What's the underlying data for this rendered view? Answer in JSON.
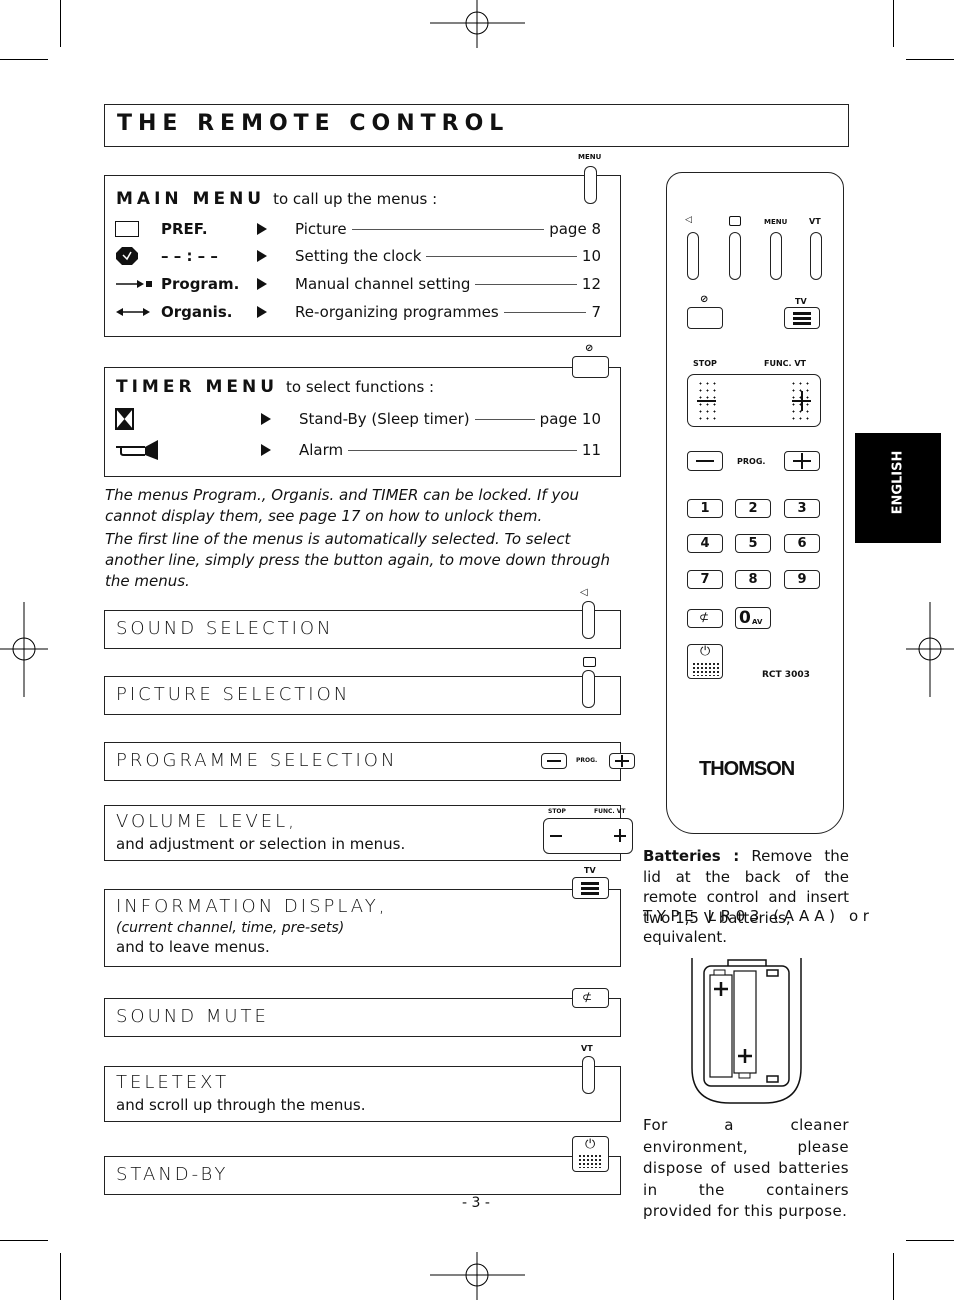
{
  "title": "THE REMOTE CONTROL",
  "language_tab": "ENGLISH",
  "page_number": "- 3 -",
  "main_menu": {
    "heading": "MAIN MENU",
    "subtitle": "to call up the menus :",
    "button_label": "MENU",
    "items": [
      {
        "icon": "screen-icon",
        "name": "PREF.",
        "desc": "Picture",
        "page": "page 8"
      },
      {
        "icon": "clock-icon",
        "name": "– – : – –",
        "desc": "Setting the clock",
        "page": "10"
      },
      {
        "icon": "arrow-right-icon",
        "name": "Program.",
        "desc": "Manual channel setting",
        "page": "12"
      },
      {
        "icon": "arrow-both-icon",
        "name": "Organis.",
        "desc": "Re-organizing programmes",
        "page": "7"
      }
    ]
  },
  "timer_menu": {
    "heading": "TIMER MENU",
    "subtitle": "to select functions :",
    "items": [
      {
        "icon": "hourglass-icon",
        "desc": "Stand-By (Sleep timer)",
        "page": "page 10"
      },
      {
        "icon": "horn-icon",
        "desc": "Alarm",
        "page": "11"
      }
    ]
  },
  "notes": [
    "The menus Program., Organis. and TIMER can be locked. If you cannot display them, see page 17 on how to unlock them.",
    "The first line of the menus is automatically selected. To select another line, simply press the button again, to move down through the menus."
  ],
  "sections": [
    {
      "heading": "SOUND SELECTION"
    },
    {
      "heading": "PICTURE SELECTION"
    },
    {
      "heading": "PROGRAMME SELECTION",
      "button_label": "PROG."
    },
    {
      "heading": "VOLUME LEVEL,",
      "line1": "and adjustment or selection in menus.",
      "labels": [
        "STOP",
        "FUNC. VT"
      ]
    },
    {
      "heading": "INFORMATION DISPLAY,",
      "line1": "(current channel, time, pre-sets)",
      "line2": "and to leave menus.",
      "button_label": "TV"
    },
    {
      "heading": "SOUND MUTE"
    },
    {
      "heading": "TELETEXT",
      "line1": "and scroll up through the menus.",
      "button_label": "VT"
    },
    {
      "heading": "STAND-BY"
    }
  ],
  "remote": {
    "top_labels": [
      "MENU",
      "VT"
    ],
    "tv_label": "TV",
    "stop_label": "STOP",
    "func_label": "FUNC. VT",
    "prog_label": "PROG.",
    "digits": [
      "1",
      "2",
      "3",
      "4",
      "5",
      "6",
      "7",
      "8",
      "9"
    ],
    "zero_label": "0",
    "av_label": "AV",
    "model": "RCT 3003",
    "brand": "THOMSON"
  },
  "batteries": {
    "bold": "Batteries :",
    "text": "Remove the lid at the back of the remote control and insert two 1,5 V batteries,",
    "type_line": "TYPE LR03 (AAA) or",
    "end": "equivalent.",
    "environment": "For a cleaner environment, please dispose of used batteries in the containers provided for this purpose."
  }
}
